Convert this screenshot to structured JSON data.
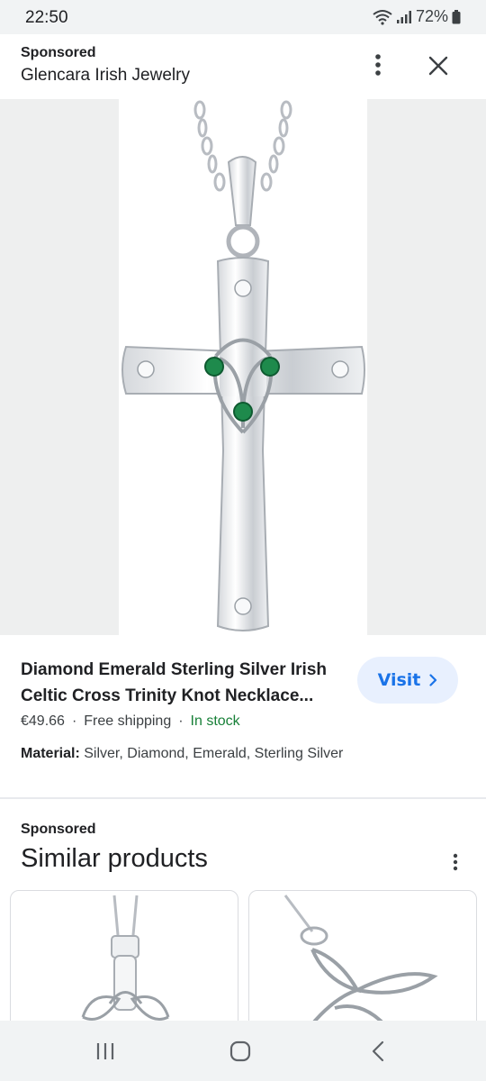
{
  "status_bar": {
    "time": "22:50",
    "battery": "72%",
    "icons": [
      "wifi-icon",
      "signal-icon",
      "battery-icon"
    ]
  },
  "ad_header": {
    "sponsored": "Sponsored",
    "seller": "Glencara Irish Jewelry",
    "icons": [
      "more-vert-icon",
      "close-icon"
    ]
  },
  "product": {
    "image_icon": "celtic-cross-necklace-image",
    "title": "Diamond Emerald Sterling Silver Irish Celtic Cross Trinity Knot Necklace...",
    "visit_label": "Visit",
    "price": "€49.66",
    "shipping": "Free shipping",
    "stock": "In stock",
    "material_label": "Material:",
    "material_value": "Silver, Diamond, Emerald, Sterling Silver"
  },
  "similar": {
    "sponsored": "Sponsored",
    "heading": "Similar products",
    "cards": [
      {
        "image_icon": "celtic-knot-pendant-image"
      },
      {
        "image_icon": "trinity-knot-pendant-image"
      }
    ]
  },
  "nav": {
    "icons": [
      "recents-icon",
      "home-icon",
      "back-icon"
    ]
  },
  "colors": {
    "accent": "#1a73e8",
    "visit_bg": "#e8f0fe",
    "stock_green": "#188038",
    "emerald": "#1e8a4c"
  }
}
